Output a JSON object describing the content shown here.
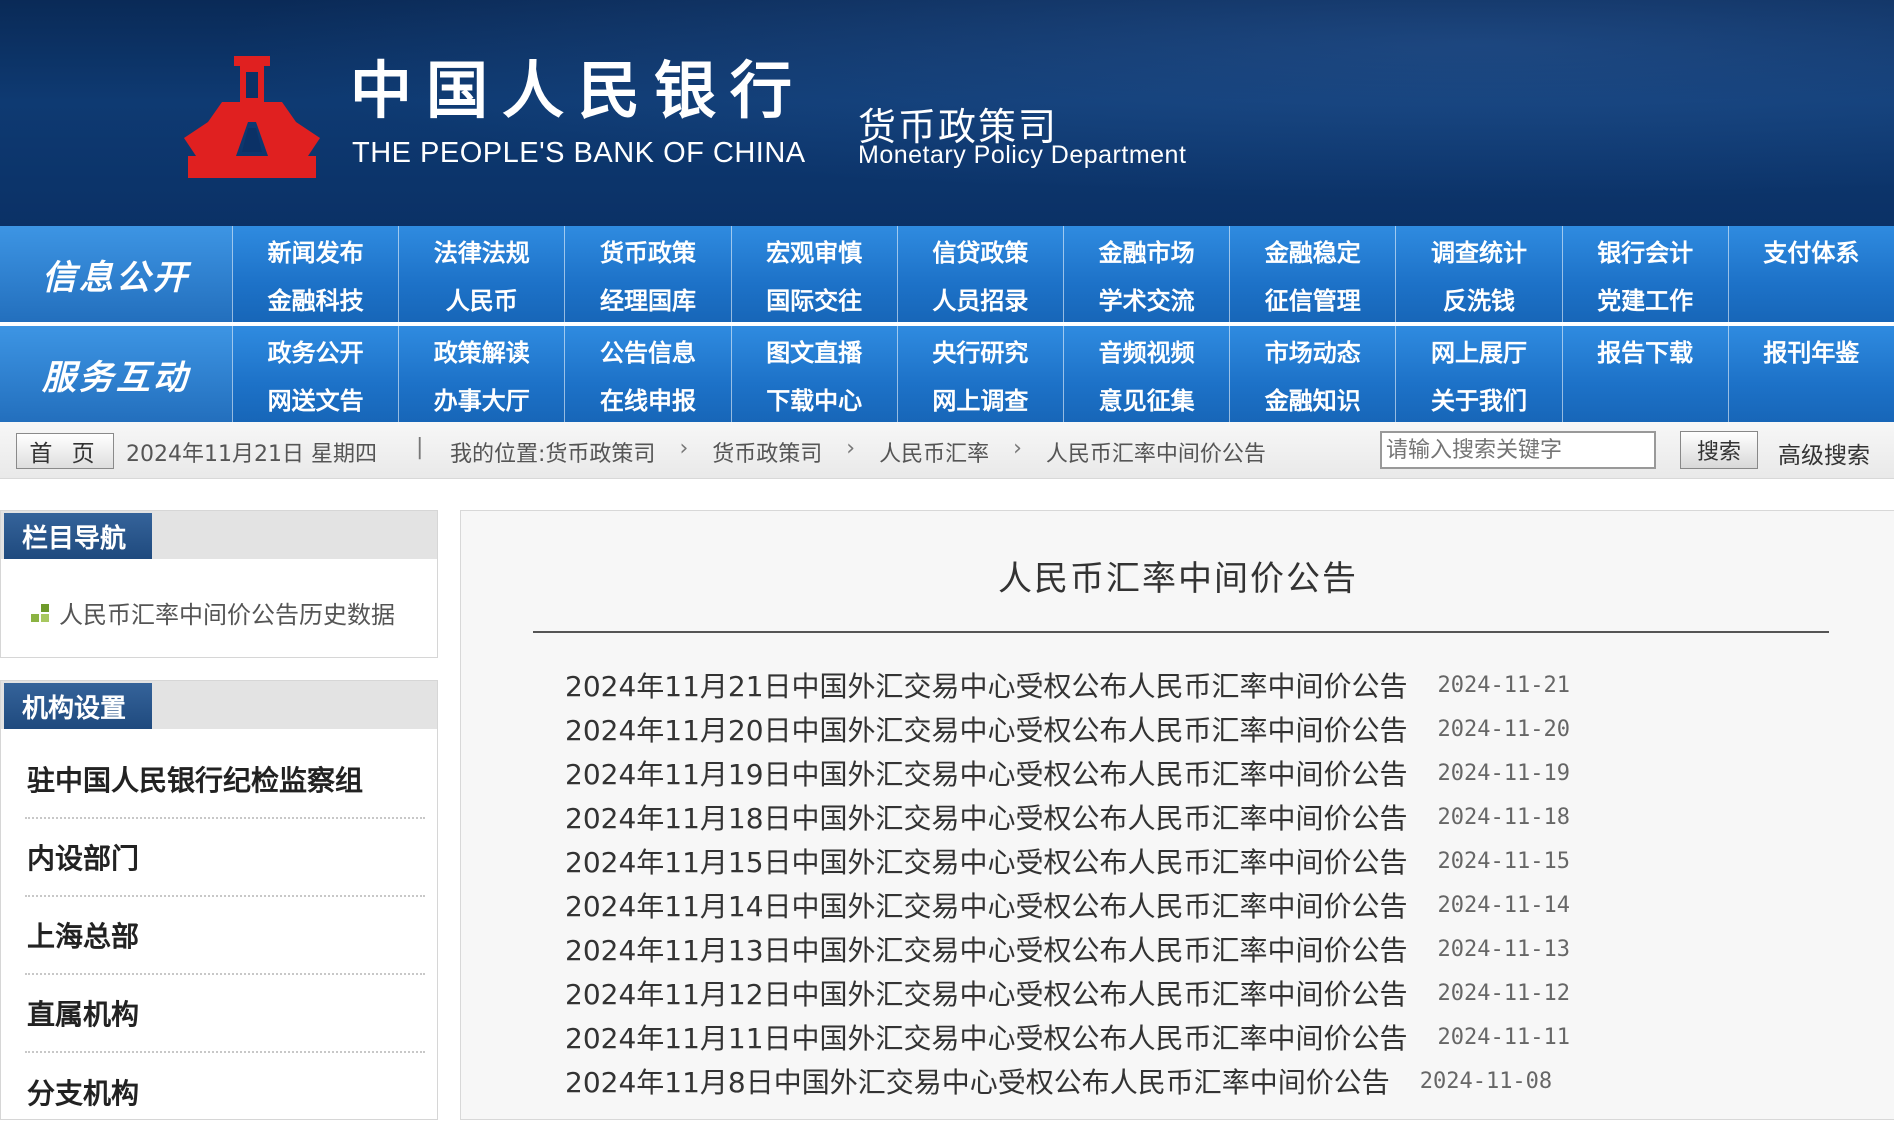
{
  "header": {
    "cn_title": "中国人民银行",
    "en_title": "THE PEOPLE'S BANK OF CHINA",
    "dept_cn": "货币政策司",
    "dept_en": "Monetary Policy Department",
    "emblem_color": "#e02020"
  },
  "nav": {
    "info_label": "信息公开",
    "info_items": [
      "新闻发布",
      "法律法规",
      "货币政策",
      "宏观审慎",
      "信贷政策",
      "金融市场",
      "金融稳定",
      "调查统计",
      "银行会计",
      "支付体系",
      "金融科技",
      "人民币",
      "经理国库",
      "国际交往",
      "人员招录",
      "学术交流",
      "征信管理",
      "反洗钱",
      "党建工作",
      ""
    ],
    "service_label": "服务互动",
    "service_items": [
      "政务公开",
      "政策解读",
      "公告信息",
      "图文直播",
      "央行研究",
      "音频视频",
      "市场动态",
      "网上展厅",
      "报告下载",
      "报刊年鉴",
      "网送文告",
      "办事大厅",
      "在线申报",
      "下载中心",
      "网上调查",
      "意见征集",
      "金融知识",
      "关于我们",
      "",
      ""
    ]
  },
  "crumb": {
    "home": "首 页",
    "date": "2024年11月21日 星期四",
    "sep": "|",
    "location_label": "我的位置:",
    "trail": [
      "货币政策司",
      "货币政策司",
      "人民币汇率",
      "人民币汇率中间价公告"
    ],
    "search_placeholder": "请输入搜索关键字",
    "search_button": "搜索",
    "advanced_search": "高级搜索"
  },
  "sidebar": {
    "nav_heading": "栏目导航",
    "history_link": "人民币汇率中间价公告历史数据",
    "org_heading": "机构设置",
    "org_items": [
      "驻中国人民银行纪检监察组",
      "内设部门",
      "上海总部",
      "直属机构",
      "分支机构"
    ]
  },
  "main": {
    "title": "人民币汇率中间价公告",
    "rows": [
      {
        "title": "2024年11月21日中国外汇交易中心受权公布人民币汇率中间价公告",
        "date": "2024-11-21"
      },
      {
        "title": "2024年11月20日中国外汇交易中心受权公布人民币汇率中间价公告",
        "date": "2024-11-20"
      },
      {
        "title": "2024年11月19日中国外汇交易中心受权公布人民币汇率中间价公告",
        "date": "2024-11-19"
      },
      {
        "title": "2024年11月18日中国外汇交易中心受权公布人民币汇率中间价公告",
        "date": "2024-11-18"
      },
      {
        "title": "2024年11月15日中国外汇交易中心受权公布人民币汇率中间价公告",
        "date": "2024-11-15"
      },
      {
        "title": "2024年11月14日中国外汇交易中心受权公布人民币汇率中间价公告",
        "date": "2024-11-14"
      },
      {
        "title": "2024年11月13日中国外汇交易中心受权公布人民币汇率中间价公告",
        "date": "2024-11-13"
      },
      {
        "title": "2024年11月12日中国外汇交易中心受权公布人民币汇率中间价公告",
        "date": "2024-11-12"
      },
      {
        "title": "2024年11月11日中国外汇交易中心受权公布人民币汇率中间价公告",
        "date": "2024-11-11"
      },
      {
        "title": "2024年11月8日中国外汇交易中心受权公布人民币汇率中间价公告",
        "date": "2024-11-08"
      }
    ]
  }
}
